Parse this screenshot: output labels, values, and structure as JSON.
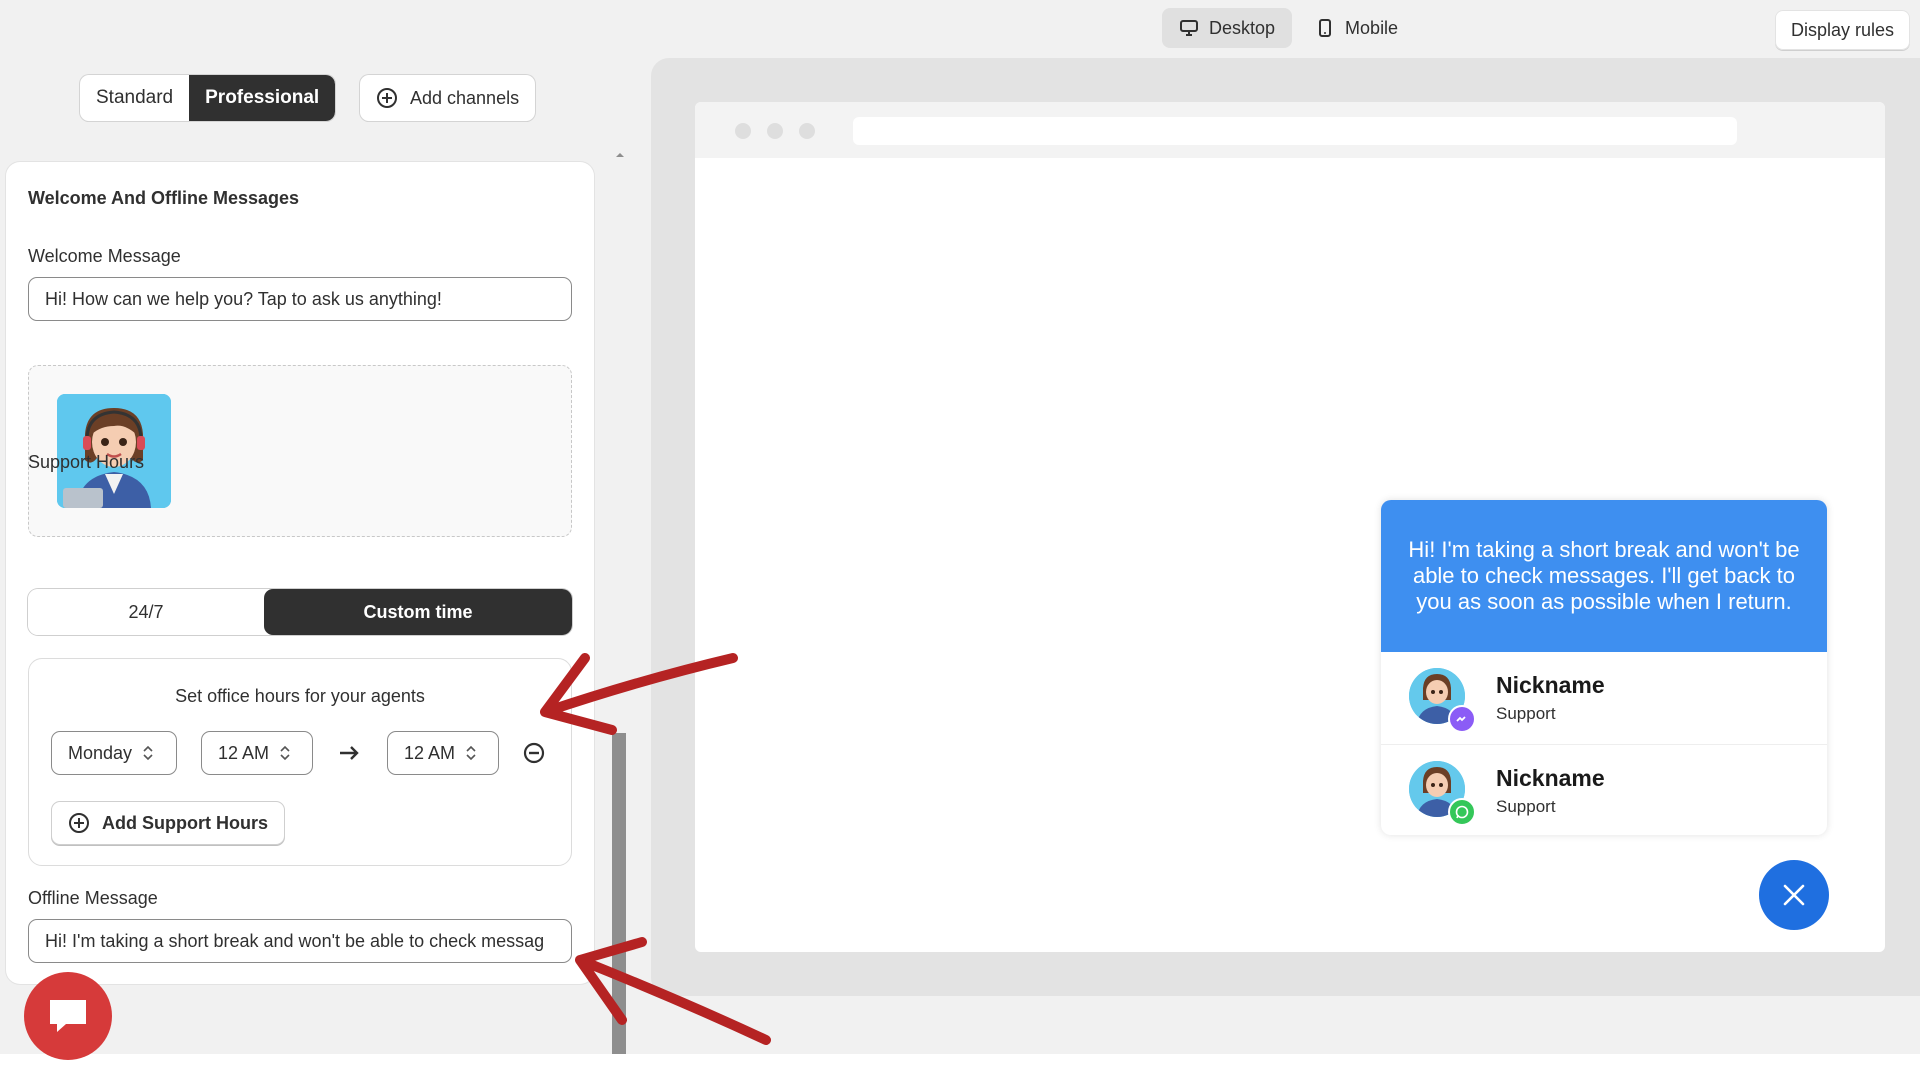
{
  "view_toggle": {
    "desktop": "Desktop",
    "mobile": "Mobile",
    "active": "Desktop"
  },
  "display_rules_label": "Display rules",
  "plan": {
    "standard": "Standard",
    "professional": "Professional",
    "active": "Professional"
  },
  "add_channels_label": "Add channels",
  "section": {
    "title": "Welcome And Offline Messages",
    "welcome_label": "Welcome Message",
    "welcome_value": "Hi! How can we help you? Tap to ask us anything!",
    "support_hours_label": "Support Hours",
    "hours_options": [
      "24/7",
      "Custom time"
    ],
    "hours_active": "Custom time",
    "office_caption": "Set office hours for your agents",
    "day": "Monday",
    "from_time": "12 AM",
    "to_time": "12 AM",
    "add_hours_label": "Add Support Hours",
    "offline_label": "Offline Message",
    "offline_value": "Hi! I'm taking a short break and won't be able to check messag"
  },
  "preview": {
    "offline_message": "Hi! I'm taking a short break and won't be able to check messages. I'll get back to you as soon as possible when I return.",
    "agents": [
      {
        "name": "Nickname",
        "role": "Support",
        "channel": "messenger-icon"
      },
      {
        "name": "Nickname",
        "role": "Support",
        "channel": "whatsapp-icon"
      }
    ]
  },
  "colors": {
    "accent_dark": "#303030",
    "widget_blue": "#3e8ff0",
    "close_button": "#1f6fe0",
    "chat_fab": "#d63a3a",
    "annotation_arrow": "#b52323"
  }
}
